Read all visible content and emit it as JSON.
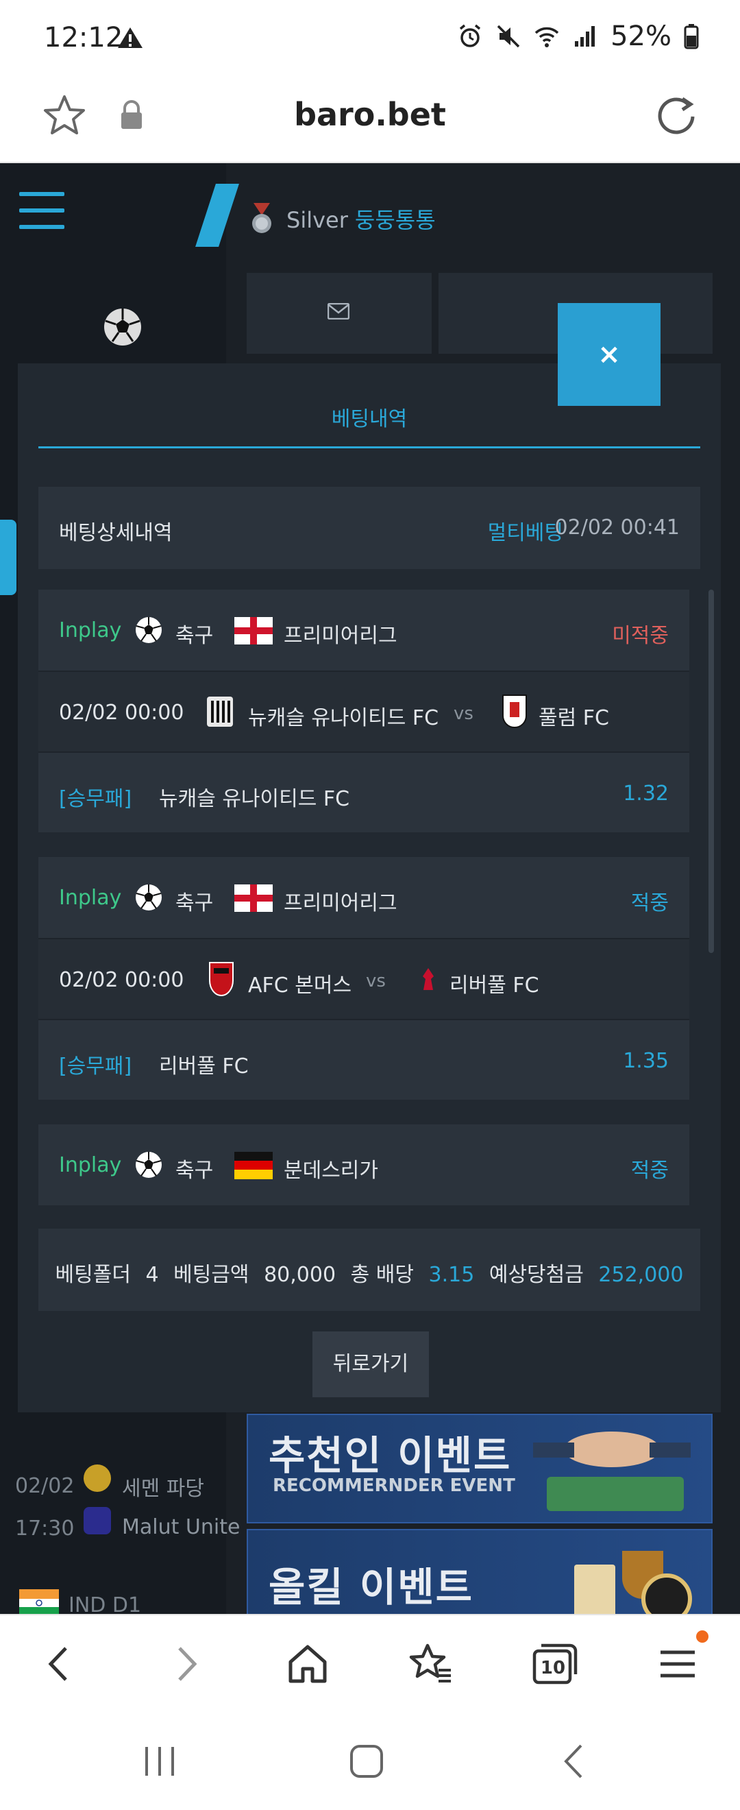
{
  "status_bar": {
    "time": "12:12",
    "battery": "52%"
  },
  "browser": {
    "url": "baro.bet"
  },
  "site": {
    "user_level": "Silver",
    "username": "둥둥통통"
  },
  "modal": {
    "tab_label": "베팅내역",
    "close_label": "×",
    "detail": {
      "label": "베팅상세내역",
      "type": "멀티베팅",
      "datetime": "02/02 00:41"
    },
    "bets": [
      {
        "inplay": "Inplay",
        "sport": "축구",
        "league": "프리미어리그",
        "status": "미적중",
        "status_color": "#e0605c",
        "match_time": "02/02 00:00",
        "home": "뉴캐슬 유나이티드 FC",
        "vs": "vs",
        "away": "풀럼 FC",
        "pick_tag": "[승무패]",
        "pick": "뉴캐슬 유나이티드 FC",
        "odds": "1.32"
      },
      {
        "inplay": "Inplay",
        "sport": "축구",
        "league": "프리미어리그",
        "status": "적중",
        "status_color": "#2aa8d8",
        "match_time": "02/02 00:00",
        "home": "AFC 본머스",
        "vs": "vs",
        "away": "리버풀 FC",
        "pick_tag": "[승무패]",
        "pick": "리버풀 FC",
        "odds": "1.35"
      },
      {
        "inplay": "Inplay",
        "sport": "축구",
        "league": "분데스리가",
        "status": "적중",
        "status_color": "#2aa8d8"
      }
    ],
    "summary": {
      "folder_label": "베팅폴더",
      "folder_count": "4",
      "amount_label": "베팅금액",
      "amount": "80,000",
      "odds_label": "총 배당",
      "total_odds": "3.15",
      "payout_label": "예상당첨금",
      "payout": "252,000"
    },
    "back_label": "뒤로가기"
  },
  "background": {
    "match_date": "02/02",
    "match_time": "17:30",
    "team_a": "세멘 파당",
    "team_b": "Malut Unite",
    "league": "IND D1",
    "banner1_title": "추천인 이벤트",
    "banner1_sub": "RECOMMERNDER EVENT",
    "banner2_title": "올킬 이벤트"
  },
  "toolbar": {
    "tabs_count": "10"
  }
}
